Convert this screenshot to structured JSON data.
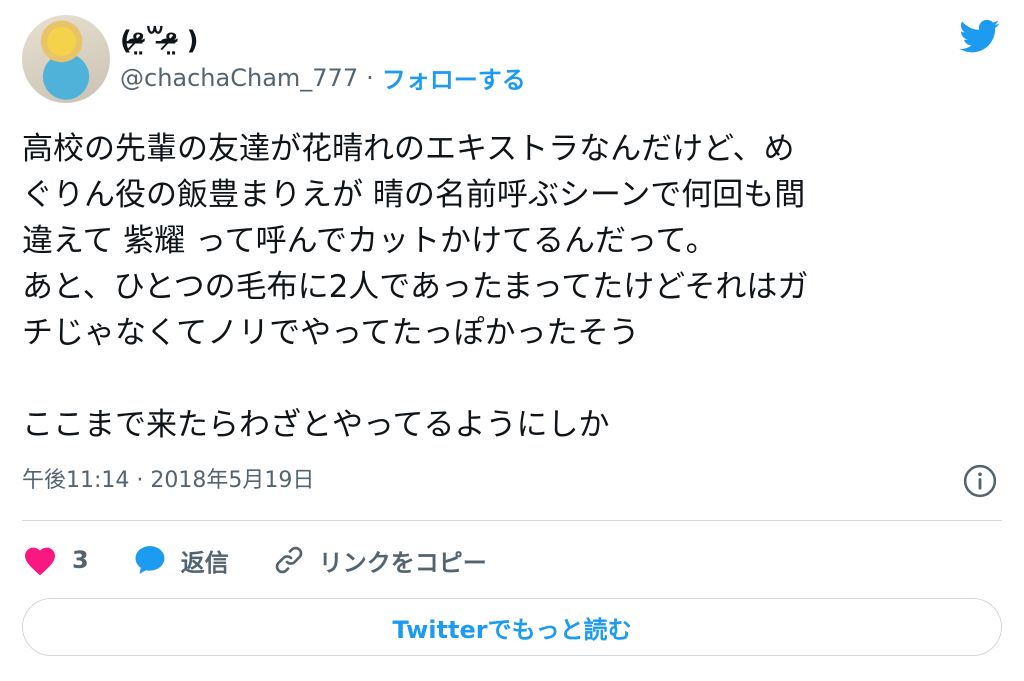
{
  "author": {
    "display_name": "(ᵒ̴̶̷̤꒳ᵒ̴̶̷̤ )",
    "handle": "@chachaCham_777",
    "separator": "·",
    "follow_label": "フォローする"
  },
  "tweet": {
    "text": "高校の先輩の友達が花晴れのエキストラなんだけど、め\nぐりん役の飯豊まりえが 晴の名前呼ぶシーンで何回も間\n違えて 紫耀 って呼んでカットかけてるんだって。\nあと、ひとつの毛布に2人であったまってたけどそれはガ\nチじゃなくてノリでやってたっぽかったそう\n\nここまで来たらわざとやってるようにしか",
    "timestamp": "午後11:14 · 2018年5月19日"
  },
  "actions": {
    "like_count": "3",
    "reply_label": "返信",
    "copy_link_label": "リンクをコピー"
  },
  "read_more_label": "Twitterでもっと読む",
  "colors": {
    "accent": "#1d9bf0",
    "like": "#f91880",
    "muted_text": "#536471",
    "border": "#cfd9de"
  },
  "icons": {
    "brand": "twitter-bird-icon",
    "info": "info-icon",
    "like": "heart-icon",
    "reply": "speech-bubble-icon",
    "copy_link": "link-icon"
  }
}
